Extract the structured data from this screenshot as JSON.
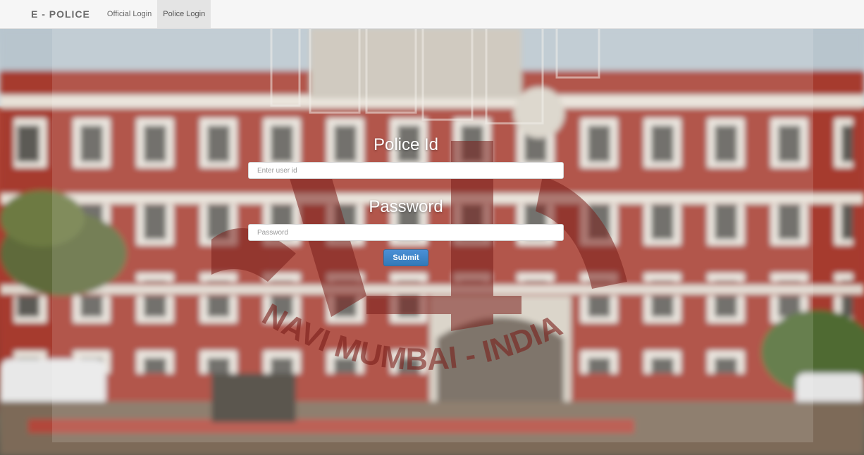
{
  "navbar": {
    "brand": "E - POLICE",
    "links": [
      {
        "label": "Official Login",
        "active": false
      },
      {
        "label": "Police Login",
        "active": true
      }
    ]
  },
  "watermark": {
    "bottom_text": "NAVI MUMBAI - INDIA"
  },
  "form": {
    "police_id_label": "Police Id",
    "police_id_placeholder": "Enter user id",
    "police_id_value": "",
    "password_label": "Password",
    "password_placeholder": "Password",
    "password_value": "",
    "submit_label": "Submit"
  },
  "colors": {
    "primary_button": "#337ab7",
    "brick": "#a83b2e",
    "watermark": "#7a1f1a"
  }
}
